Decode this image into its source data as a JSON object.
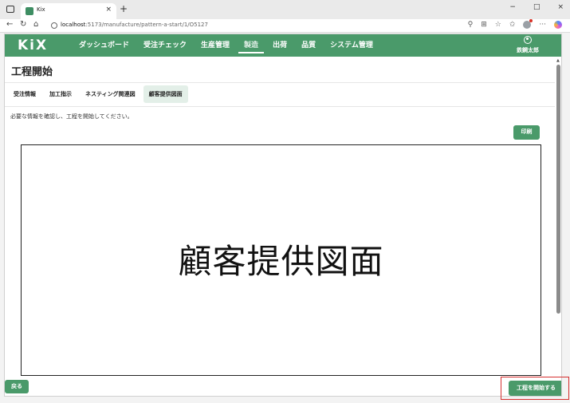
{
  "browser": {
    "tab_title": "Kix",
    "tab_close": "×",
    "new_tab": "+",
    "window_controls": [
      "−",
      "□",
      "×"
    ],
    "url_host": "localhost",
    "url_path": ":5173/manufacture/pattern-a-start/1/O5127",
    "tools": [
      "⚲",
      "⊞",
      "☆",
      "✩",
      "···"
    ]
  },
  "header": {
    "logo": "KiX",
    "nav": [
      {
        "label": "ダッシュボード"
      },
      {
        "label": "受注チェック"
      },
      {
        "label": "生産管理"
      },
      {
        "label": "製造",
        "active": true
      },
      {
        "label": "出荷"
      },
      {
        "label": "品質"
      },
      {
        "label": "システム管理"
      }
    ],
    "user_name": "鉄鋼太郎"
  },
  "page": {
    "title": "工程開始",
    "tabs": [
      {
        "label": "受注情報"
      },
      {
        "label": "加工指示"
      },
      {
        "label": "ネスティング関連図"
      },
      {
        "label": "顧客提供図面",
        "active": true
      }
    ],
    "instructions": "必要な情報を確認し、工程を開始してください。",
    "print_label": "印刷",
    "drawing_label": "顧客提供図面",
    "back_label": "戻る",
    "start_label": "工程を開始する"
  },
  "colors": {
    "primary": "#4a9a6a",
    "highlight": "#d63030"
  }
}
